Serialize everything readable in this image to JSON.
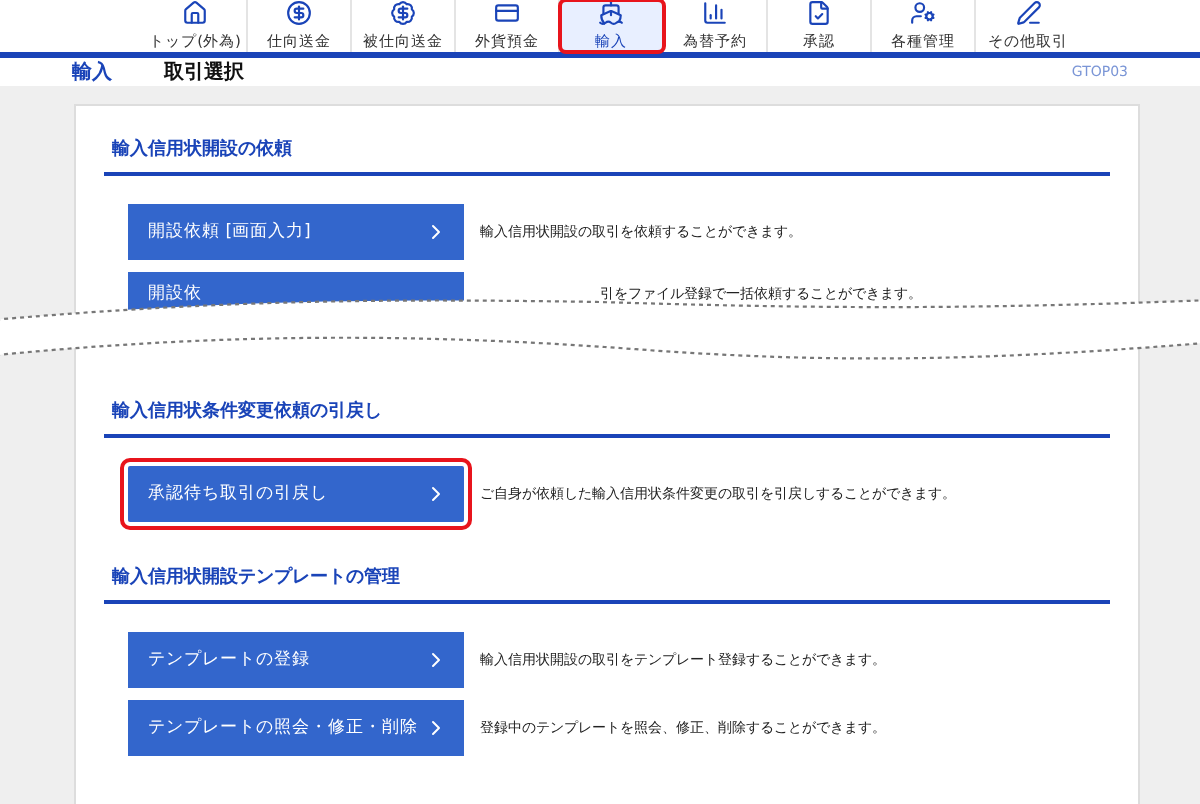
{
  "nav": [
    {
      "label": "トップ(外為)",
      "selected": false
    },
    {
      "label": "仕向送金",
      "selected": false
    },
    {
      "label": "被仕向送金",
      "selected": false
    },
    {
      "label": "外貨預金",
      "selected": false
    },
    {
      "label": "輸入",
      "selected": true
    },
    {
      "label": "為替予約",
      "selected": false
    },
    {
      "label": "承認",
      "selected": false
    },
    {
      "label": "各種管理",
      "selected": false
    },
    {
      "label": "その他取引",
      "selected": false
    }
  ],
  "breadcrumb": {
    "section": "輸入",
    "page": "取引選択",
    "screen_id": "GTOP03"
  },
  "sections": [
    {
      "title": "輸入信用状開設の依頼",
      "items": [
        {
          "button": "開設依頼 [画面入力]",
          "description": "輸入信用状開設の取引を依頼することができます。",
          "highlighted": false
        },
        {
          "button": "開設依",
          "description": "引をファイル登録で一括依頼することができます。",
          "highlighted": false,
          "torn": true
        }
      ]
    },
    {
      "title": "輸入信用状条件変更依頼の引戻し",
      "items": [
        {
          "button": "承認待ち取引の引戻し",
          "description": "ご自身が依頼した輸入信用状条件変更の取引を引戻しすることができます。",
          "highlighted": true
        }
      ]
    },
    {
      "title": "輸入信用状開設テンプレートの管理",
      "items": [
        {
          "button": "テンプレートの登録",
          "description": "輸入信用状開設の取引をテンプレート登録することができます。",
          "highlighted": false
        },
        {
          "button": "テンプレートの照会・修正・削除",
          "description": "登録中のテンプレートを照会、修正、削除することができます。",
          "highlighted": false
        }
      ]
    }
  ]
}
